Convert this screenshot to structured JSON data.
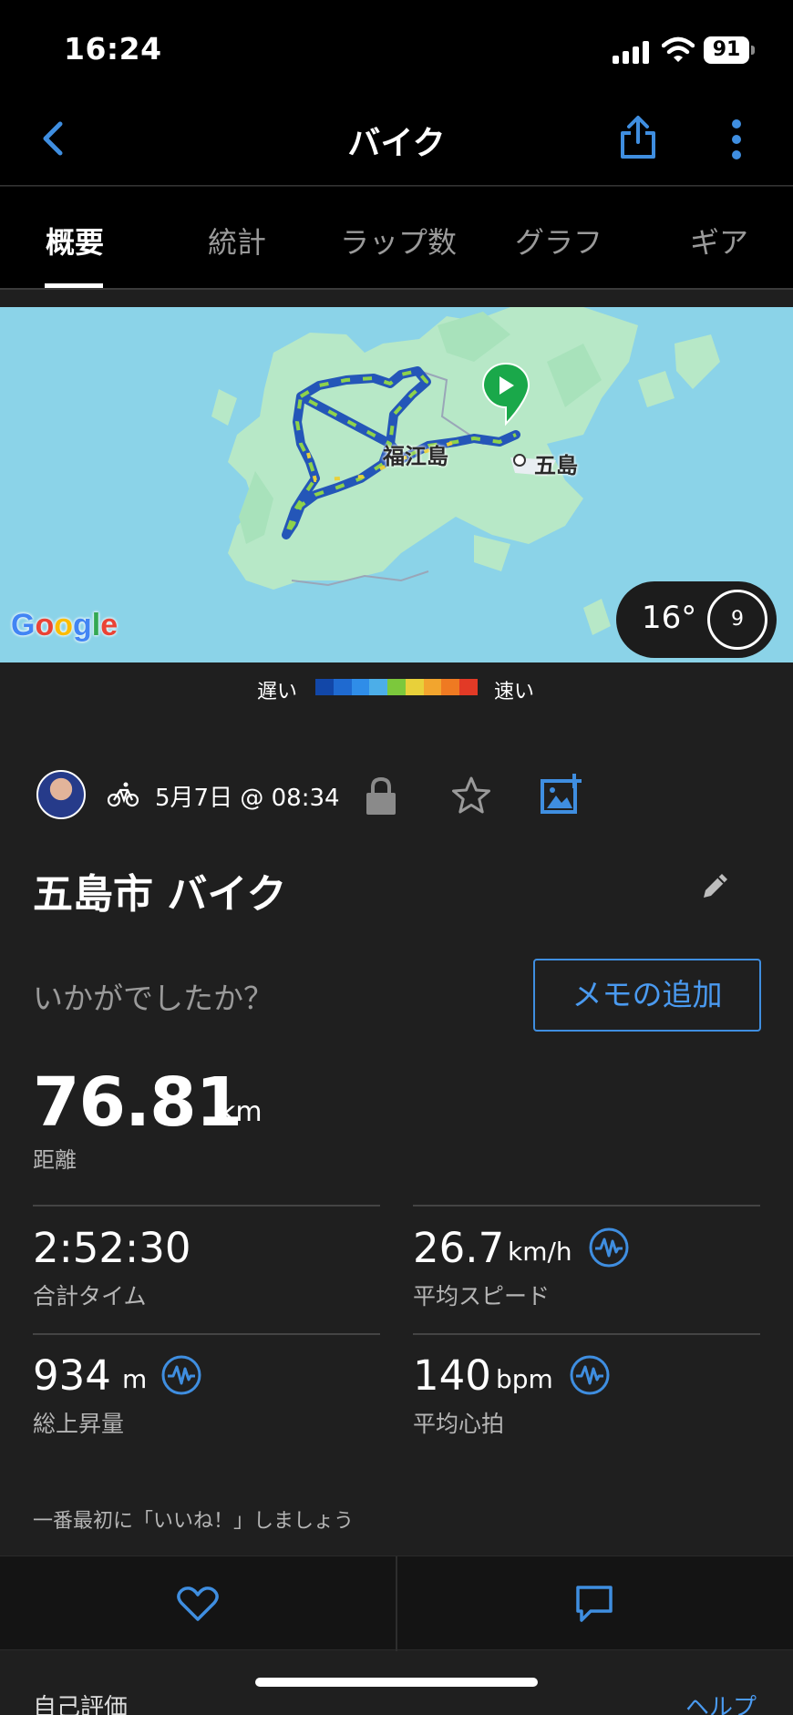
{
  "status_bar": {
    "time": "16:24",
    "battery": "91"
  },
  "nav": {
    "title": "バイク",
    "back_icon": "chevron-left-icon",
    "share_icon": "share-icon",
    "more_icon": "more-vertical-icon"
  },
  "tabs": [
    {
      "label": "概要",
      "active": true
    },
    {
      "label": "統計",
      "active": false
    },
    {
      "label": "ラップ数",
      "active": false
    },
    {
      "label": "グラフ",
      "active": false
    },
    {
      "label": "ギア",
      "active": false
    }
  ],
  "map": {
    "labels": {
      "island": "福江島",
      "town": "五島"
    },
    "attribution": "Google",
    "weather": {
      "temp": "16°",
      "wind": "9"
    },
    "legend": {
      "slow": "遅い",
      "fast": "速い",
      "colors": [
        "#1247a8",
        "#1f6ad0",
        "#2f8de8",
        "#4caee8",
        "#7cc83c",
        "#e8d03a",
        "#f2a52e",
        "#ef7a22",
        "#e23a26"
      ]
    }
  },
  "activity": {
    "date": "5月7日 @ 08:34",
    "title": "五島市 バイク",
    "feeling_prompt": "いかがでしたか？",
    "memo_button": "メモの追加",
    "distance": {
      "value": "76.81",
      "unit": "km",
      "label": "距離"
    },
    "stats": [
      {
        "value": "2:52:30",
        "unit": "",
        "label": "合計タイム"
      },
      {
        "value": "26.7",
        "unit": "km/h",
        "label": "平均スピード"
      },
      {
        "value": "934",
        "unit": "m",
        "label": "総上昇量"
      },
      {
        "value": "140",
        "unit": "bpm",
        "label": "平均心拍"
      }
    ],
    "like_prompt": "一番最初に「いいね！」しましょう"
  },
  "footer": {
    "self_eval": "自己評価",
    "help": "ヘルプ"
  },
  "colors": {
    "accent": "#4a9af0",
    "background": "#1f1f1f",
    "bar": "#000000"
  }
}
